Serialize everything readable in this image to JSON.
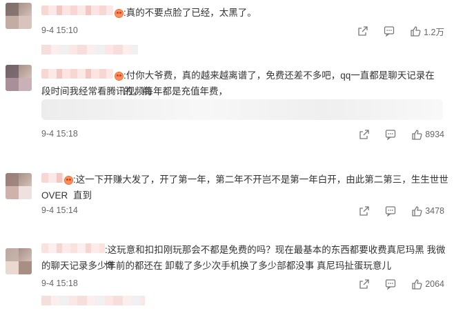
{
  "comments": [
    {
      "text": ":真的不要点脸了已经，太黑了。",
      "time": "9-4 15:10",
      "likes": "1.2万"
    },
    {
      "text_line1": ":付你大爷费，真的越来越离谱了，免费还差不多吧，qq一直都是聊天记录在的，前",
      "text_line2": "段时间我经常看腾讯视频每年都是充值年费，",
      "time": "9-4 15:18",
      "likes": "8934"
    },
    {
      "text_line1": ":这一下开赚大发了，开了第一年，第二年不开岂不是第一年白开，由此第二第三，生生世世直到",
      "text_line2": "OVER",
      "time": "9-4 15:14",
      "likes": "3478"
    },
    {
      "text_line1": ":这玩意和扣扣刚玩那会不都是免费的吗？现在最基本的东西都要收费真尼玛黑 我微博",
      "text_line2": "的聊天记录多少年前的都还在 卸载了多少次手机换了多少部都没事 真尼玛扯蛋玩意儿",
      "time": "9-4 15:18",
      "likes": "2064"
    }
  ],
  "icons": {
    "share": "share-icon",
    "comment": "comment-icon",
    "like": "thumbs-up-icon",
    "emoji": "emoji-icon"
  },
  "colors": {
    "text": "#333333",
    "meta": "#666666",
    "mosaic_pink": "#f7d5d1"
  }
}
